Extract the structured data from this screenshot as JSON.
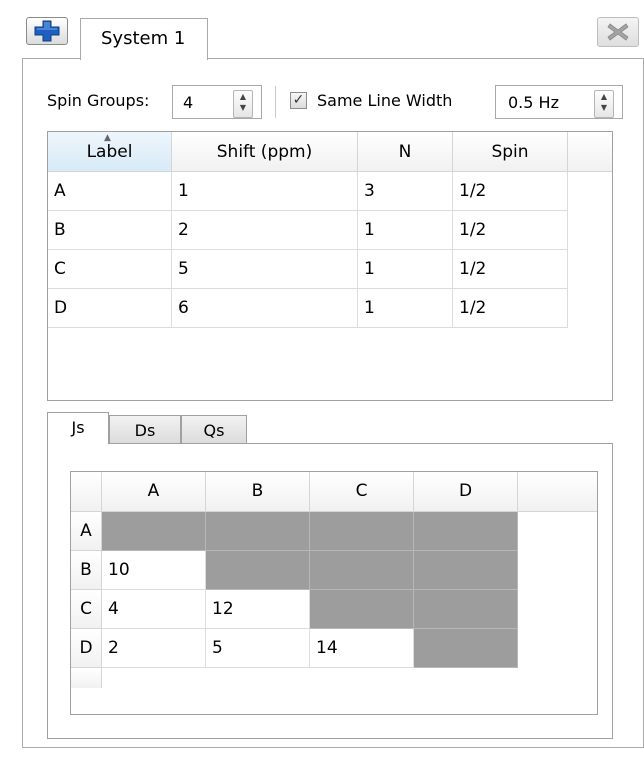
{
  "window": {
    "tab_title": "System 1",
    "add_tab_icon": "blue-plus-icon",
    "close_tab_icon": "gray-x-icon"
  },
  "options": {
    "spin_groups_label": "Spin Groups:",
    "spin_groups_value": "4",
    "same_line_width_label": "Same Line Width",
    "same_line_width_checked": true,
    "line_width_value": "0.5 Hz"
  },
  "spin_table": {
    "columns": [
      "Label",
      "Shift (ppm)",
      "N",
      "Spin"
    ],
    "sorted_column": "Label",
    "rows": [
      [
        "A",
        "1",
        "3",
        "1/2"
      ],
      [
        "B",
        "2",
        "1",
        "1/2"
      ],
      [
        "C",
        "5",
        "1",
        "1/2"
      ],
      [
        "D",
        "6",
        "1",
        "1/2"
      ]
    ]
  },
  "coupling_tabs": {
    "tabs": [
      "Js",
      "Ds",
      "Qs"
    ],
    "active": "Js"
  },
  "j_matrix": {
    "columns": [
      "A",
      "B",
      "C",
      "D"
    ],
    "rows": [
      {
        "label": "A",
        "cells": [
          null,
          null,
          null,
          null
        ]
      },
      {
        "label": "B",
        "cells": [
          "10",
          null,
          null,
          null
        ]
      },
      {
        "label": "C",
        "cells": [
          "4",
          "12",
          null,
          null
        ]
      },
      {
        "label": "D",
        "cells": [
          "2",
          "5",
          "14",
          null
        ]
      }
    ]
  },
  "colors": {
    "disabled_cell": "#9d9d9d",
    "add_icon_blue": "#1f5fbf",
    "header_selected": "#d8eaf7"
  }
}
